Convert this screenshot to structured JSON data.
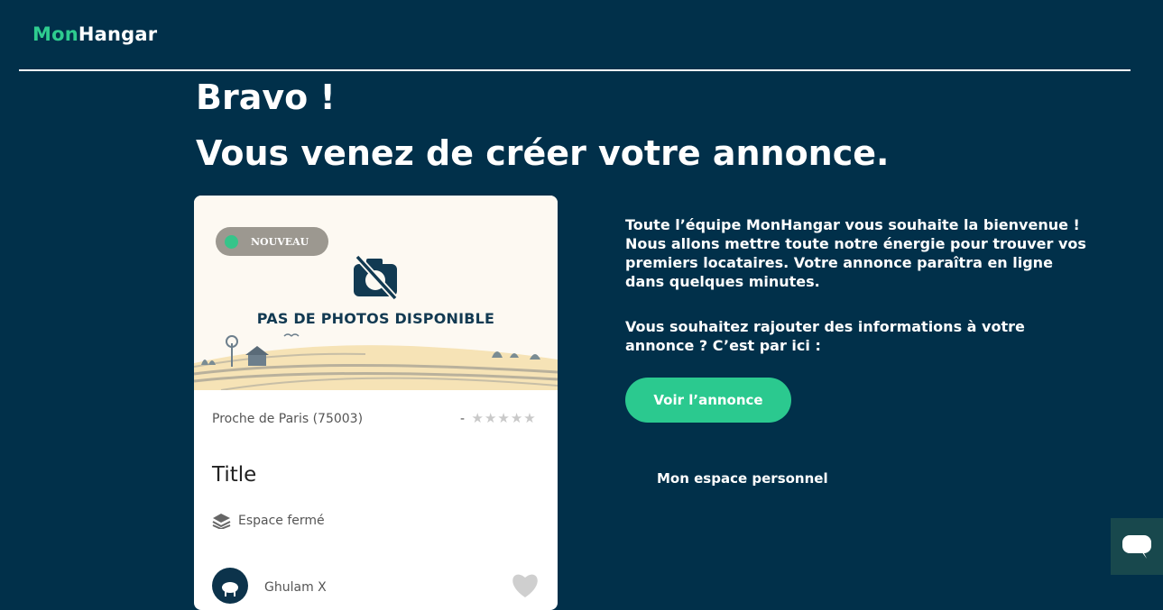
{
  "header": {
    "logo_part1": "Mon",
    "logo_part2": "Hangar",
    "logo_colors": {
      "part1": "#2ecc8f",
      "part2": "#ffffff"
    }
  },
  "main": {
    "heading_line1": "Bravo !",
    "heading_line2": "Vous venez de créer votre annonce."
  },
  "card": {
    "badge_label": "NOUVEAU",
    "no_photo_text": "PAS DE PHOTOS DISPONIBLE",
    "location": "Proche de Paris (75003)",
    "rating_prefix": "-",
    "rating_stars": "★★★★★",
    "rating_value": 0,
    "title": "Title",
    "space_type": "Espace fermé",
    "owner_name": "Ghulam X"
  },
  "panel": {
    "welcome_text": "Toute l’équipe MonHangar vous souhaite la bienvenue ! Nous allons mettre toute notre énergie pour trouver vos premiers locataires. Votre annonce paraîtra en ligne dans quelques minutes.",
    "question_text": "Vous souhaitez rajouter des informations à votre annonce ? C’est par ici :",
    "view_button_label": "Voir l’annonce",
    "personal_space_label": "Mon espace personnel"
  },
  "colors": {
    "background": "#01304a",
    "accent": "#2bc98f",
    "badge_dot": "#36c48a",
    "chat_button": "#18484d"
  },
  "icons": {
    "no_photo": "camera-off-icon",
    "stack": "stack-icon",
    "heart": "heart-icon",
    "chat": "chat-icon",
    "avatar": "sheep-icon"
  }
}
